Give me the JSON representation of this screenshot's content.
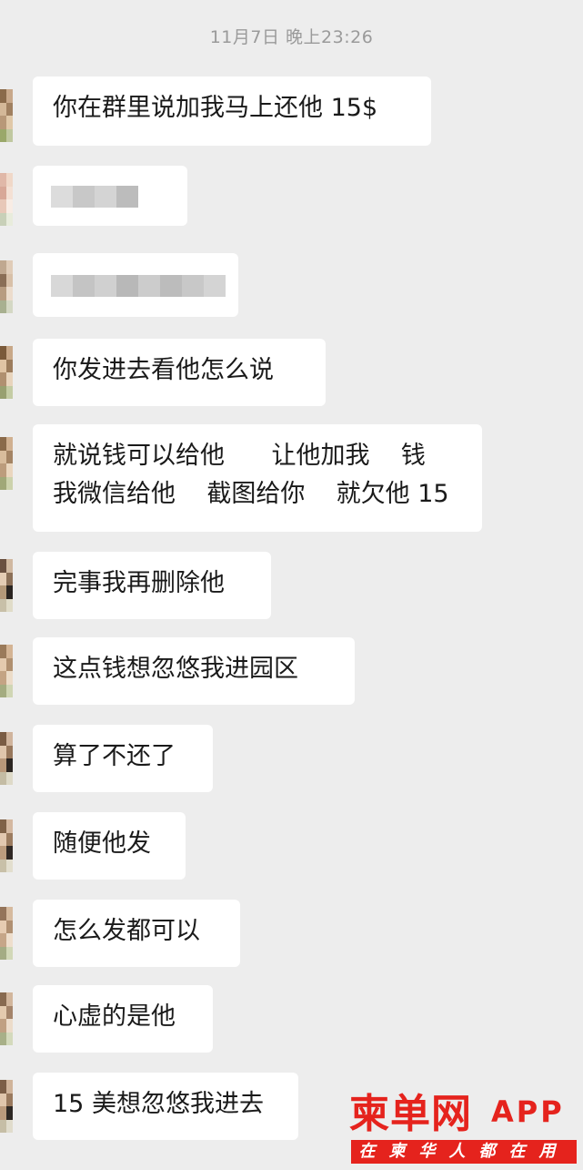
{
  "header": {
    "timestamp": "11月7日 晚上23:26"
  },
  "messages": [
    {
      "text": "你在群里说加我马上还他 15$"
    },
    {
      "text": ""
    },
    {
      "text": ""
    },
    {
      "text": "你发进去看他怎么说"
    },
    {
      "text": "就说钱可以给他      让他加我    钱\n我微信给他    截图给你    就欠他 15"
    },
    {
      "text": "完事我再删除他"
    },
    {
      "text": "这点钱想忽悠我进园区"
    },
    {
      "text": "算了不还了"
    },
    {
      "text": "随便他发"
    },
    {
      "text": "怎么发都可以"
    },
    {
      "text": "心虚的是他"
    },
    {
      "text": "15 美想忽悠我进去"
    }
  ],
  "watermark": {
    "brand": "柬单网",
    "app_label": "APP",
    "tagline": "在柬华人都在用"
  },
  "colors": {
    "background": "#ededed",
    "bubble": "#ffffff",
    "timestamp_text": "#9a9a9a",
    "brand_red": "#e5231d"
  }
}
